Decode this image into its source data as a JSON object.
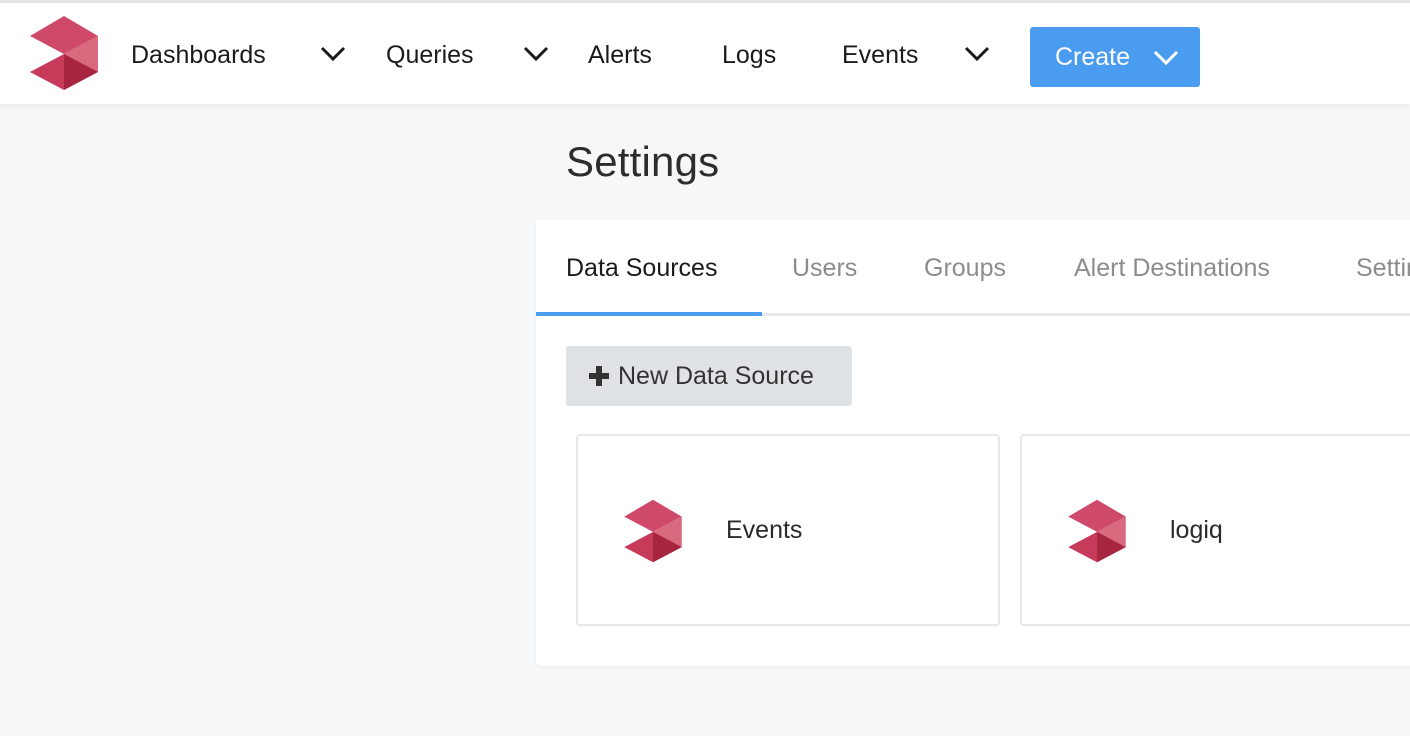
{
  "nav": {
    "items": [
      {
        "label": "Dashboards",
        "has_dropdown": true
      },
      {
        "label": "Queries",
        "has_dropdown": true
      },
      {
        "label": "Alerts",
        "has_dropdown": false
      },
      {
        "label": "Logs",
        "has_dropdown": false
      },
      {
        "label": "Events",
        "has_dropdown": true
      }
    ],
    "create_label": "Create"
  },
  "page": {
    "title": "Settings"
  },
  "tabs": [
    {
      "label": "Data Sources",
      "active": true
    },
    {
      "label": "Users",
      "active": false
    },
    {
      "label": "Groups",
      "active": false
    },
    {
      "label": "Alert Destinations",
      "active": false
    },
    {
      "label": "Settings",
      "active": false
    }
  ],
  "actions": {
    "new_data_source_label": "New Data Source"
  },
  "data_sources": [
    {
      "name": "Events",
      "icon": "logiq-logo-icon"
    },
    {
      "name": "logiq",
      "icon": "logiq-logo-icon"
    }
  ],
  "colors": {
    "accent": "#4a9cf0",
    "logo_light": "#d35a78",
    "logo_mid": "#c73a5a",
    "logo_dark": "#a8253f",
    "background": "#f6f7f9"
  }
}
